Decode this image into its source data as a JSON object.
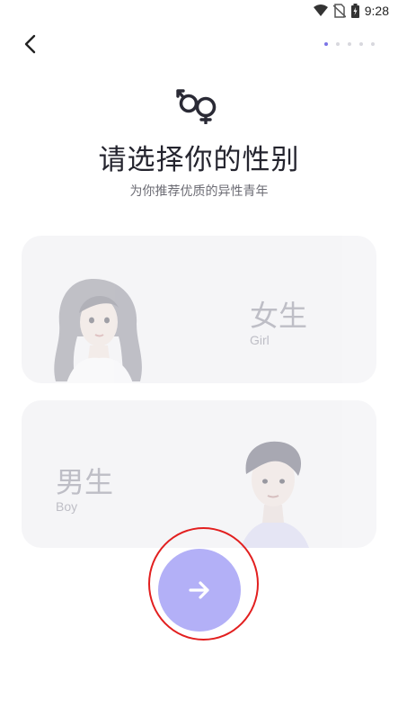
{
  "status_bar": {
    "time": "9:28",
    "icons": [
      "wifi-icon",
      "no-sim-icon",
      "battery-icon"
    ]
  },
  "header": {
    "back_icon": "chevron-left-icon",
    "step_total": 5,
    "step_current": 1
  },
  "hero": {
    "icon": "gender-symbol-icon",
    "title": "请选择你的性别",
    "subtitle": "为你推荐优质的异性青年"
  },
  "options": {
    "female": {
      "label": "女生",
      "sub": "Girl"
    },
    "male": {
      "label": "男生",
      "sub": "Boy"
    }
  },
  "next_button": {
    "icon": "arrow-right-icon"
  },
  "colors": {
    "accent": "#7b74e6",
    "button_bg": "#b3b0f7",
    "card_bg": "#f5f5f7",
    "highlight": "#e21f1f"
  }
}
